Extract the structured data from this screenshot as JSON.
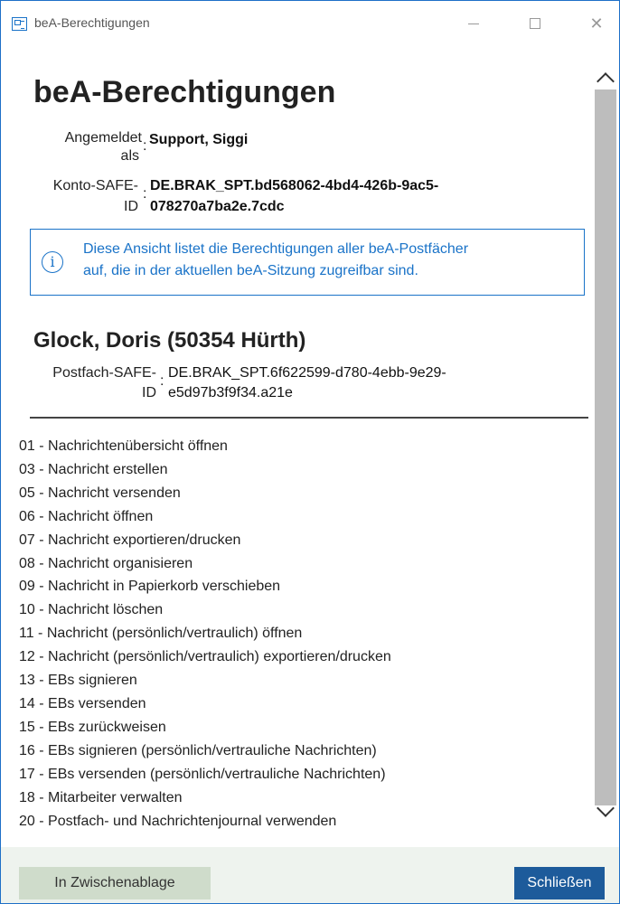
{
  "window": {
    "title": "beA-Berechtigungen"
  },
  "header": {
    "title": "beA-Berechtigungen",
    "logged_in_label_line1": "Angemeldet",
    "logged_in_label_line2": "als",
    "logged_in_value": "Support, Siggi",
    "account_label_line1": "Konto-SAFE-",
    "account_label_line2": "ID",
    "account_value_line1": "DE.BRAK_SPT.bd568062-4bd4-426b-9ac5-",
    "account_value_line2": "078270a7ba2e.7cdc",
    "colon": ":"
  },
  "info": {
    "text_line1": "Diese Ansicht listet die Berechtigungen aller beA-Postfächer",
    "text_line2": "auf, die in der aktuellen beA-Sitzung zugreifbar sind.",
    "icon_glyph": "i"
  },
  "mailbox": {
    "name": "Glock, Doris (50354 Hürth)",
    "safe_label_line1": "Postfach-SAFE-",
    "safe_label_line2": "ID",
    "safe_value_line1": "DE.BRAK_SPT.6f622599-d780-4ebb-9e29-",
    "safe_value_line2": "e5d97b3f9f34.a21e",
    "permissions": [
      "01 - Nachrichtenübersicht öffnen",
      "03 - Nachricht erstellen",
      "05 - Nachricht versenden",
      "06 - Nachricht öffnen",
      "07 - Nachricht exportieren/drucken",
      "08 - Nachricht organisieren",
      "09 - Nachricht in Papierkorb verschieben",
      "10 - Nachricht löschen",
      "11 - Nachricht (persönlich/vertraulich) öffnen",
      "12 - Nachricht (persönlich/vertraulich) exportieren/drucken",
      "13 - EBs signieren",
      "14 - EBs versenden",
      "15 - EBs zurückweisen",
      "16 - EBs signieren (persönlich/vertrauliche Nachrichten)",
      "17 - EBs versenden (persönlich/vertrauliche Nachrichten)",
      "18 - Mitarbeiter verwalten",
      "20 - Postfach- und Nachrichtenjournal verwenden"
    ]
  },
  "footer": {
    "copy_label": "In Zwischenablage",
    "close_label": "Schließen"
  },
  "colors": {
    "accent": "#1a73c8",
    "close_button": "#1d5b9b",
    "copy_button": "#cfdccb",
    "footer_bg": "#eef3ee",
    "scroll_thumb": "#bdbdbd"
  },
  "icons": {
    "app": "app-window-icon",
    "minimize": "minimize-icon",
    "maximize": "maximize-icon",
    "close": "close-icon",
    "info": "info-icon",
    "scroll_up": "chevron-up-icon",
    "scroll_down": "chevron-down-icon"
  }
}
